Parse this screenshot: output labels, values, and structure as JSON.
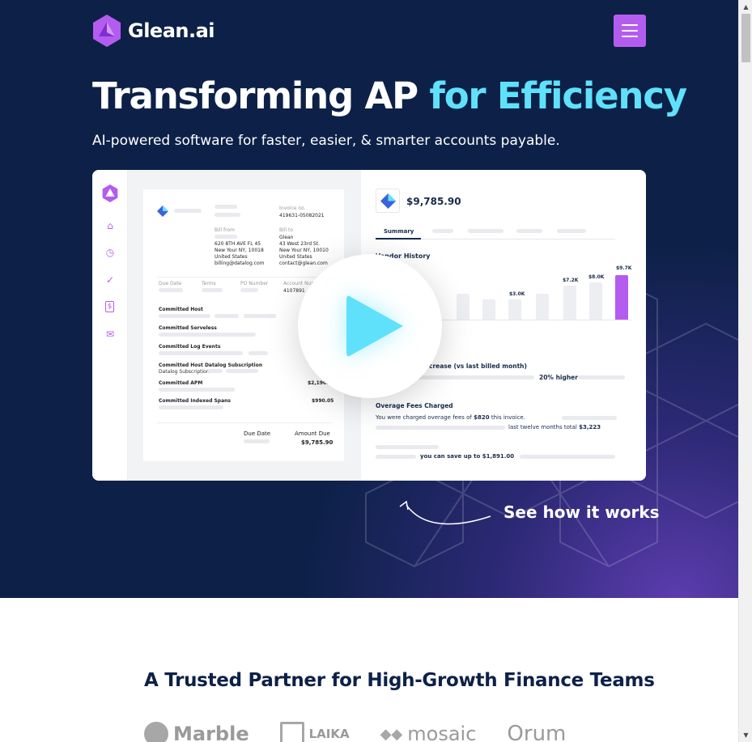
{
  "brand": {
    "name": "Glean.ai",
    "logo_icon": "glean-logo-icon",
    "accent": "#b45cf0",
    "cyan": "#5fe1fc",
    "navy": "#0d2148"
  },
  "header": {
    "menu_icon": "hamburger-menu-icon"
  },
  "hero": {
    "headline_main": "Transforming AP ",
    "headline_accent": "for Efficiency",
    "subhead": "AI-powered software for faster, easier, & smarter accounts payable.",
    "cta": "See how it works"
  },
  "preview": {
    "sidebar_icons": [
      "glean-logo-icon",
      "home-icon",
      "clock-icon",
      "check-circle-icon",
      "dollar-doc-icon",
      "mail-icon"
    ],
    "invoice": {
      "invoice_no_label": "Invoice no.",
      "invoice_no": "419631-05082021",
      "bill_from_label": "Bill from",
      "bill_from": [
        "620 8TH AVE FL 45",
        "New Your NY, 10018",
        "United States",
        "billing@datalog.com"
      ],
      "bill_to_label": "Bill to",
      "bill_to": [
        "Glean",
        "43 West 23rd St.",
        "New Your NY, 10010",
        "United States",
        "contact@glean.com"
      ],
      "cols": [
        "Due Date",
        "Terms",
        "PO Number",
        "Account Num"
      ],
      "account_num": "4107891",
      "lines": [
        {
          "name": "Committed Host",
          "amount": ""
        },
        {
          "name": "Committed Serveless",
          "amount": ""
        },
        {
          "name": "Committed Log Events",
          "amount": ""
        },
        {
          "name": "Committed Host\nDatalog Subscription",
          "amount": ""
        },
        {
          "name": "Committed APM",
          "amount": "$2,190.2"
        },
        {
          "name": "Committed Indexed Spans",
          "amount": "$990.05"
        }
      ],
      "due_date_label": "Due Date",
      "amount_due_label": "Amount Due",
      "amount_due": "$9,785.90"
    },
    "summary": {
      "total": "$9,785.90",
      "tab_active": "Summary",
      "vendor_history_title": "Vendor History",
      "bar_labels": [
        "$3.0K",
        "$7.2K",
        "$8.0K",
        "$9.7K"
      ],
      "increase_text": "crease (vs last billed month)",
      "increase_value": "20% higher",
      "overage_title": "Overage Fees Charged",
      "overage_line_pre": "You were charged overage fees of ",
      "overage_amount": "$820",
      "overage_line_post": " this invoice.",
      "twelve_months": "last twelve months total ",
      "twelve_months_total": "$3,223",
      "savings_pre": "you can save up to ",
      "savings_amount": "$1,891.00"
    },
    "play_icon": "play-icon"
  },
  "partners": {
    "title": "A Trusted Partner for High-Growth Finance Teams",
    "logos": [
      "Marble",
      "LAIKA",
      "mosaic",
      "Orum"
    ]
  }
}
